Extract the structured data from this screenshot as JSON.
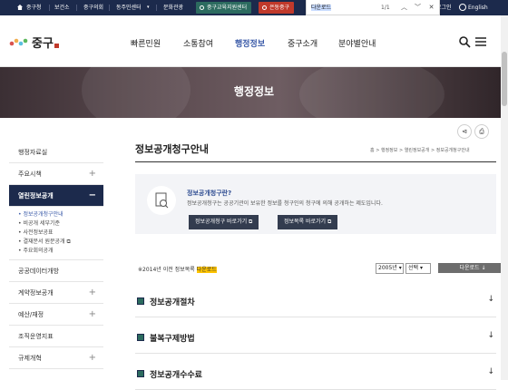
{
  "topbar": {
    "links": [
      "중구청",
      "보건소",
      "중구의회",
      "동주민센터",
      "문화관광"
    ],
    "btn_education": "중구교육지원센터",
    "btn_eungong": "은동중구",
    "login": "로그인",
    "english": "English",
    "colors": {
      "bg": "#1c2a4c",
      "edu": "#2c6b5f",
      "eun": "#c0392b"
    }
  },
  "find": {
    "query": "다운로드",
    "count": "1/1"
  },
  "header": {
    "logo_text": "중구",
    "nav": [
      "빠른민원",
      "소통참여",
      "행정정보",
      "중구소개",
      "분야별안내"
    ]
  },
  "banner": {
    "title": "행정정보"
  },
  "sidebar": {
    "items": [
      {
        "label": "행정자료실",
        "plus": ""
      },
      {
        "label": "주요시책",
        "plus": "+"
      },
      {
        "label": "열린정보공개",
        "plus": "−"
      }
    ],
    "sub": [
      "정보공개청구안내",
      "비공개 세부기준",
      "사전정보공표",
      "결재문서 원문공개",
      "주요회의공개"
    ],
    "items2": [
      {
        "label": "공공데이터개방",
        "plus": ""
      },
      {
        "label": "계약정보공개",
        "plus": "+"
      },
      {
        "label": "예산/재정",
        "plus": "+"
      },
      {
        "label": "조직운영지표",
        "plus": ""
      },
      {
        "label": "규제개혁",
        "plus": "+"
      }
    ]
  },
  "main": {
    "title": "정보공개청구안내",
    "breadcrumb": [
      "홈",
      "행정정보",
      "열린정보공개",
      "정보공개청구안내"
    ],
    "info_q": "정보공개청구란?",
    "info_desc": "정보공개청구는 공공기관이 보유한 정보를 청구인의 청구에 의해 공개하는 제도입니다.",
    "btn1": "정보공개청구 바로가기",
    "btn2": "정보목록 바로가기",
    "archive_prefix": "※2014년 이전 정보목록 ",
    "archive_hl": "다운로드",
    "year": "2005년",
    "select": "선택",
    "download": "다운로드",
    "sections": [
      "정보공개절차",
      "불복구제방법",
      "정보공개수수료"
    ]
  }
}
